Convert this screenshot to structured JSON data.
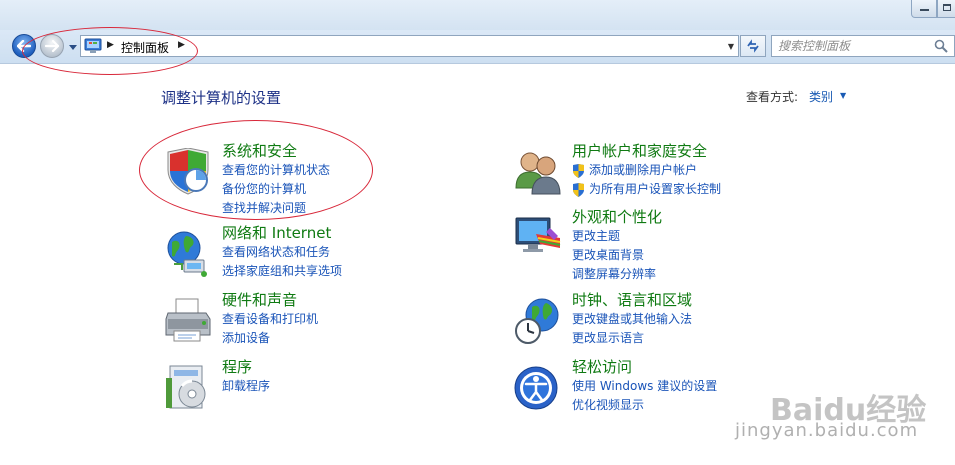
{
  "window": {
    "controls": [
      "minimize",
      "maximize"
    ]
  },
  "navigation": {
    "back_icon": "back-arrow-icon",
    "forward_icon": "forward-arrow-icon",
    "address": {
      "crumb": "控制面板"
    },
    "search": {
      "placeholder": "搜索控制面板"
    }
  },
  "main": {
    "title": "调整计算机的设置",
    "view_by": {
      "label": "查看方式:",
      "value": "类别"
    }
  },
  "categories": {
    "system": {
      "icon": "shield-icon",
      "title": "系统和安全",
      "links": [
        "查看您的计算机状态",
        "备份您的计算机",
        "查找并解决问题"
      ]
    },
    "network": {
      "icon": "globe-network-icon",
      "title": "网络和 Internet",
      "links": [
        "查看网络状态和任务",
        "选择家庭组和共享选项"
      ]
    },
    "hardware": {
      "icon": "printer-icon",
      "title": "硬件和声音",
      "links": [
        "查看设备和打印机",
        "添加设备"
      ]
    },
    "programs": {
      "icon": "programs-icon",
      "title": "程序",
      "links": [
        "卸载程序"
      ]
    },
    "users": {
      "icon": "users-icon",
      "title": "用户帐户和家庭安全",
      "links": [
        "添加或删除用户帐户",
        "为所有用户设置家长控制"
      ]
    },
    "appearance": {
      "icon": "monitor-appearance-icon",
      "title": "外观和个性化",
      "links": [
        "更改主题",
        "更改桌面背景",
        "调整屏幕分辨率"
      ]
    },
    "clock": {
      "icon": "clock-globe-icon",
      "title": "时钟、语言和区域",
      "links": [
        "更改键盘或其他输入法",
        "更改显示语言"
      ]
    },
    "ease": {
      "icon": "ease-of-access-icon",
      "title": "轻松访问",
      "links": [
        "使用 Windows 建议的设置",
        "优化视频显示"
      ]
    }
  },
  "watermark": {
    "brand": "Baidu经验",
    "url": "jingyan.baidu.com"
  },
  "colors": {
    "title_blue": "#1e3287",
    "category_green": "#0f7a12",
    "link_blue": "#1a54b8",
    "annotation_red": "#d8283a"
  }
}
